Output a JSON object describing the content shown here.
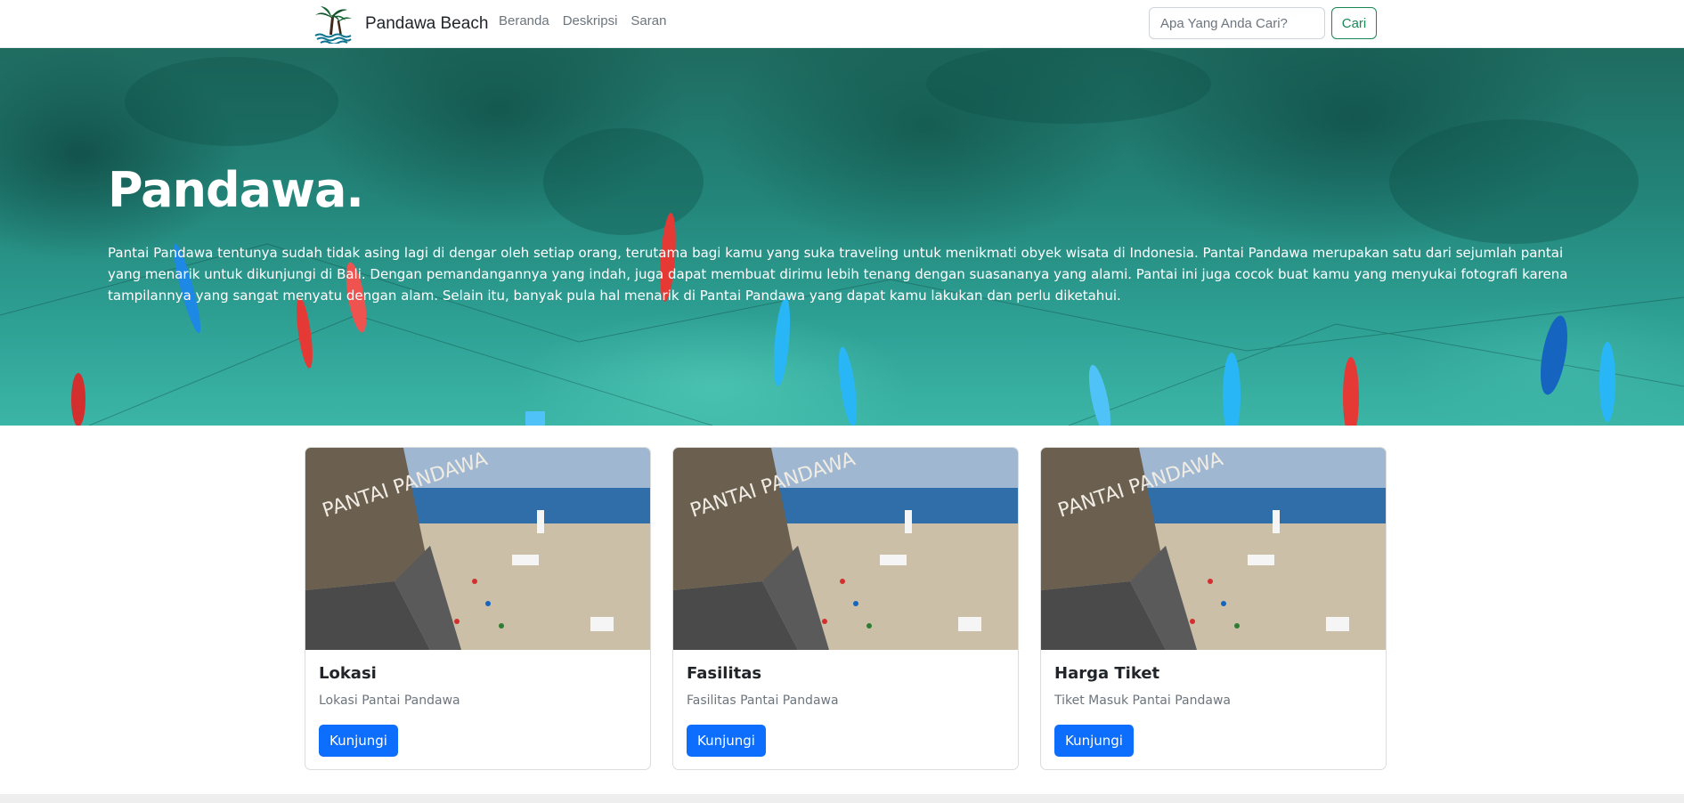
{
  "navbar": {
    "brand_name": "Pandawa Beach",
    "brand_logo": "palm-tree-icon",
    "links": [
      "Beranda",
      "Deskripsi",
      "Saran"
    ],
    "search": {
      "placeholder": "Apa Yang Anda Cari?",
      "value": "",
      "button_label": "Cari"
    }
  },
  "hero": {
    "title": "Pandawa.",
    "text": "Pantai Pandawa tentunya sudah tidak asing lagi di dengar oleh setiap orang, terutama bagi kamu yang suka traveling untuk menikmati obyek wisata di Indonesia. Pantai Pandawa merupakan satu dari sejumlah pantai yang menarik untuk dikunjungi di Bali. Dengan pemandangannya yang indah, juga dapat membuat dirimu lebih tenang dengan suasananya yang alami. Pantai ini juga cocok buat kamu yang menyukai fotografi karena tampilannya yang sangat menyatu dengan alam. Selain itu, banyak pula hal menarik di Pantai Pandawa yang dapat kamu lakukan dan perlu diketahui."
  },
  "cards": [
    {
      "title": "Lokasi",
      "subtitle": "Lokasi Pantai Pandawa",
      "button_label": "Kunjungi"
    },
    {
      "title": "Fasilitas",
      "subtitle": "Fasilitas Pantai Pandawa",
      "button_label": "Kunjungi"
    },
    {
      "title": "Harga Tiket",
      "subtitle": "Tiket Masuk Pantai Pandawa",
      "button_label": "Kunjungi"
    }
  ],
  "colors": {
    "primary_button": "#0d6efd",
    "search_button": "#198754",
    "hero_sea": "#23857a"
  }
}
